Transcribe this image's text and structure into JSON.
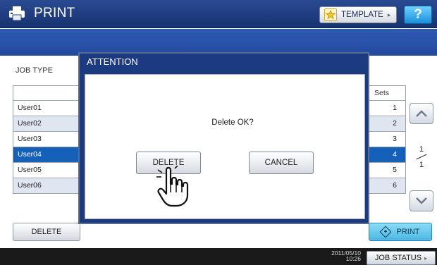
{
  "header": {
    "title": "PRINT",
    "template_label": "TEMPLATE",
    "help_label": "?"
  },
  "main": {
    "job_type_label": "JOB TYPE",
    "sets_header": "Sets",
    "rows": [
      {
        "name": "User01",
        "sets": "1",
        "state": "normal"
      },
      {
        "name": "User02",
        "sets": "2",
        "state": "alt"
      },
      {
        "name": "User03",
        "sets": "3",
        "state": "normal"
      },
      {
        "name": "User04",
        "sets": "4",
        "state": "selected"
      },
      {
        "name": "User05",
        "sets": "5",
        "state": "normal"
      },
      {
        "name": "User06",
        "sets": "6",
        "state": "alt"
      }
    ],
    "page_current": "1",
    "page_total": "1",
    "delete_label": "DELETE",
    "print_label": "PRINT"
  },
  "footer": {
    "date": "2011/05/10",
    "time": "10:26",
    "job_status_label": "JOB STATUS"
  },
  "dialog": {
    "title": "ATTENTION",
    "message": "Delete OK?",
    "delete_label": "DELETE",
    "cancel_label": "CANCEL"
  },
  "icons": {
    "header": "printer-icon",
    "template": "star-icon",
    "scroll_up": "chevron-up-icon",
    "scroll_down": "chevron-down-icon",
    "print": "diamond-start-icon",
    "pointer": "hand-pointer-icon"
  },
  "colors": {
    "header_bg": "#1f3f85",
    "band_bg": "#2a55ad",
    "selected_row": "#1560b8",
    "alt_row": "#dfe5f1",
    "help_button": "#2aa3e8",
    "print_button": "#5cc3ea"
  }
}
